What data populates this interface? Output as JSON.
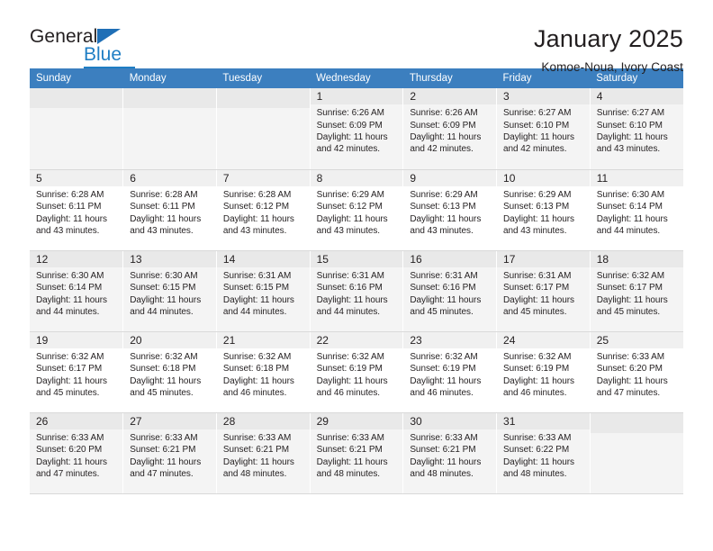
{
  "brand": {
    "name_part1": "General",
    "name_part2": "Blue"
  },
  "header": {
    "title": "January 2025",
    "subtitle": "Komoe-Noua, Ivory Coast"
  },
  "weekday_headers": [
    "Sunday",
    "Monday",
    "Tuesday",
    "Wednesday",
    "Thursday",
    "Friday",
    "Saturday"
  ],
  "labels": {
    "sunrise_prefix": "Sunrise: ",
    "sunset_prefix": "Sunset: ",
    "daylight_prefix": "Daylight: "
  },
  "colors": {
    "header_band": "#3c7fbf",
    "brand_blue": "#1f7ec4",
    "text": "#231f20",
    "row_shade": "#f4f4f4",
    "daynum_shade": "#f0f0f0"
  },
  "weeks": [
    [
      {
        "day": "",
        "empty": true
      },
      {
        "day": "",
        "empty": true
      },
      {
        "day": "",
        "empty": true
      },
      {
        "day": "1",
        "sunrise": "Sunrise: 6:26 AM",
        "sunset": "Sunset: 6:09 PM",
        "daylight_l1": "Daylight: 11 hours",
        "daylight_l2": "and 42 minutes."
      },
      {
        "day": "2",
        "sunrise": "Sunrise: 6:26 AM",
        "sunset": "Sunset: 6:09 PM",
        "daylight_l1": "Daylight: 11 hours",
        "daylight_l2": "and 42 minutes."
      },
      {
        "day": "3",
        "sunrise": "Sunrise: 6:27 AM",
        "sunset": "Sunset: 6:10 PM",
        "daylight_l1": "Daylight: 11 hours",
        "daylight_l2": "and 42 minutes."
      },
      {
        "day": "4",
        "sunrise": "Sunrise: 6:27 AM",
        "sunset": "Sunset: 6:10 PM",
        "daylight_l1": "Daylight: 11 hours",
        "daylight_l2": "and 43 minutes."
      }
    ],
    [
      {
        "day": "5",
        "sunrise": "Sunrise: 6:28 AM",
        "sunset": "Sunset: 6:11 PM",
        "daylight_l1": "Daylight: 11 hours",
        "daylight_l2": "and 43 minutes."
      },
      {
        "day": "6",
        "sunrise": "Sunrise: 6:28 AM",
        "sunset": "Sunset: 6:11 PM",
        "daylight_l1": "Daylight: 11 hours",
        "daylight_l2": "and 43 minutes."
      },
      {
        "day": "7",
        "sunrise": "Sunrise: 6:28 AM",
        "sunset": "Sunset: 6:12 PM",
        "daylight_l1": "Daylight: 11 hours",
        "daylight_l2": "and 43 minutes."
      },
      {
        "day": "8",
        "sunrise": "Sunrise: 6:29 AM",
        "sunset": "Sunset: 6:12 PM",
        "daylight_l1": "Daylight: 11 hours",
        "daylight_l2": "and 43 minutes."
      },
      {
        "day": "9",
        "sunrise": "Sunrise: 6:29 AM",
        "sunset": "Sunset: 6:13 PM",
        "daylight_l1": "Daylight: 11 hours",
        "daylight_l2": "and 43 minutes."
      },
      {
        "day": "10",
        "sunrise": "Sunrise: 6:29 AM",
        "sunset": "Sunset: 6:13 PM",
        "daylight_l1": "Daylight: 11 hours",
        "daylight_l2": "and 43 minutes."
      },
      {
        "day": "11",
        "sunrise": "Sunrise: 6:30 AM",
        "sunset": "Sunset: 6:14 PM",
        "daylight_l1": "Daylight: 11 hours",
        "daylight_l2": "and 44 minutes."
      }
    ],
    [
      {
        "day": "12",
        "sunrise": "Sunrise: 6:30 AM",
        "sunset": "Sunset: 6:14 PM",
        "daylight_l1": "Daylight: 11 hours",
        "daylight_l2": "and 44 minutes."
      },
      {
        "day": "13",
        "sunrise": "Sunrise: 6:30 AM",
        "sunset": "Sunset: 6:15 PM",
        "daylight_l1": "Daylight: 11 hours",
        "daylight_l2": "and 44 minutes."
      },
      {
        "day": "14",
        "sunrise": "Sunrise: 6:31 AM",
        "sunset": "Sunset: 6:15 PM",
        "daylight_l1": "Daylight: 11 hours",
        "daylight_l2": "and 44 minutes."
      },
      {
        "day": "15",
        "sunrise": "Sunrise: 6:31 AM",
        "sunset": "Sunset: 6:16 PM",
        "daylight_l1": "Daylight: 11 hours",
        "daylight_l2": "and 44 minutes."
      },
      {
        "day": "16",
        "sunrise": "Sunrise: 6:31 AM",
        "sunset": "Sunset: 6:16 PM",
        "daylight_l1": "Daylight: 11 hours",
        "daylight_l2": "and 45 minutes."
      },
      {
        "day": "17",
        "sunrise": "Sunrise: 6:31 AM",
        "sunset": "Sunset: 6:17 PM",
        "daylight_l1": "Daylight: 11 hours",
        "daylight_l2": "and 45 minutes."
      },
      {
        "day": "18",
        "sunrise": "Sunrise: 6:32 AM",
        "sunset": "Sunset: 6:17 PM",
        "daylight_l1": "Daylight: 11 hours",
        "daylight_l2": "and 45 minutes."
      }
    ],
    [
      {
        "day": "19",
        "sunrise": "Sunrise: 6:32 AM",
        "sunset": "Sunset: 6:17 PM",
        "daylight_l1": "Daylight: 11 hours",
        "daylight_l2": "and 45 minutes."
      },
      {
        "day": "20",
        "sunrise": "Sunrise: 6:32 AM",
        "sunset": "Sunset: 6:18 PM",
        "daylight_l1": "Daylight: 11 hours",
        "daylight_l2": "and 45 minutes."
      },
      {
        "day": "21",
        "sunrise": "Sunrise: 6:32 AM",
        "sunset": "Sunset: 6:18 PM",
        "daylight_l1": "Daylight: 11 hours",
        "daylight_l2": "and 46 minutes."
      },
      {
        "day": "22",
        "sunrise": "Sunrise: 6:32 AM",
        "sunset": "Sunset: 6:19 PM",
        "daylight_l1": "Daylight: 11 hours",
        "daylight_l2": "and 46 minutes."
      },
      {
        "day": "23",
        "sunrise": "Sunrise: 6:32 AM",
        "sunset": "Sunset: 6:19 PM",
        "daylight_l1": "Daylight: 11 hours",
        "daylight_l2": "and 46 minutes."
      },
      {
        "day": "24",
        "sunrise": "Sunrise: 6:32 AM",
        "sunset": "Sunset: 6:19 PM",
        "daylight_l1": "Daylight: 11 hours",
        "daylight_l2": "and 46 minutes."
      },
      {
        "day": "25",
        "sunrise": "Sunrise: 6:33 AM",
        "sunset": "Sunset: 6:20 PM",
        "daylight_l1": "Daylight: 11 hours",
        "daylight_l2": "and 47 minutes."
      }
    ],
    [
      {
        "day": "26",
        "sunrise": "Sunrise: 6:33 AM",
        "sunset": "Sunset: 6:20 PM",
        "daylight_l1": "Daylight: 11 hours",
        "daylight_l2": "and 47 minutes."
      },
      {
        "day": "27",
        "sunrise": "Sunrise: 6:33 AM",
        "sunset": "Sunset: 6:21 PM",
        "daylight_l1": "Daylight: 11 hours",
        "daylight_l2": "and 47 minutes."
      },
      {
        "day": "28",
        "sunrise": "Sunrise: 6:33 AM",
        "sunset": "Sunset: 6:21 PM",
        "daylight_l1": "Daylight: 11 hours",
        "daylight_l2": "and 48 minutes."
      },
      {
        "day": "29",
        "sunrise": "Sunrise: 6:33 AM",
        "sunset": "Sunset: 6:21 PM",
        "daylight_l1": "Daylight: 11 hours",
        "daylight_l2": "and 48 minutes."
      },
      {
        "day": "30",
        "sunrise": "Sunrise: 6:33 AM",
        "sunset": "Sunset: 6:21 PM",
        "daylight_l1": "Daylight: 11 hours",
        "daylight_l2": "and 48 minutes."
      },
      {
        "day": "31",
        "sunrise": "Sunrise: 6:33 AM",
        "sunset": "Sunset: 6:22 PM",
        "daylight_l1": "Daylight: 11 hours",
        "daylight_l2": "and 48 minutes."
      },
      {
        "day": "",
        "empty": true
      }
    ]
  ]
}
